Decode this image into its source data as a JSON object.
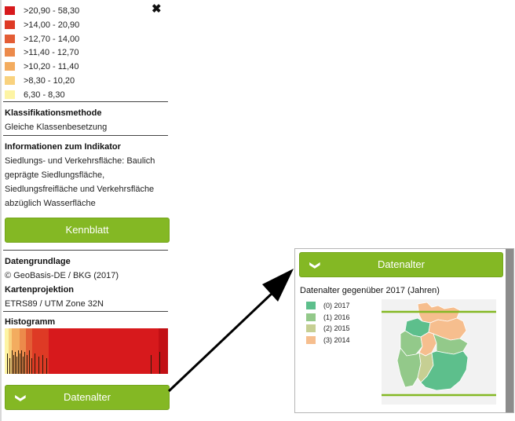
{
  "legend": {
    "classes": [
      {
        "label": ">20,90 - 58,30",
        "color": "#d7191c"
      },
      {
        "label": ">14,00 - 20,90",
        "color": "#de3a25"
      },
      {
        "label": ">12,70 - 14,00",
        "color": "#e35d35"
      },
      {
        "label": ">11,40 - 12,70",
        "color": "#ec8a4b"
      },
      {
        "label": ">10,20 - 11,40",
        "color": "#f3ac5f"
      },
      {
        "label": ">8,30 - 10,20",
        "color": "#f9d27e"
      },
      {
        "label": "6,30 - 8,30",
        "color": "#fdf4a4"
      }
    ]
  },
  "close_icon": "close-icon",
  "classification": {
    "heading": "Klassifikationsmethode",
    "value": "Gleiche Klassenbesetzung"
  },
  "indicator_info": {
    "heading": "Informationen zum Indikator",
    "lines": [
      "Siedlungs- und Verkehrsfläche: Baulich",
      "geprägte Siedlungsfläche,",
      "Siedlungsfreifläche und Verkehrsfläche",
      "abzüglich Wasserfläche"
    ]
  },
  "kennblatt_label": "Kennblatt",
  "data_basis": {
    "heading": "Datengrundlage",
    "value": "© GeoBasis-DE / BKG (2017)"
  },
  "projection": {
    "heading": "Kartenprojektion",
    "value": "ETRS89 / UTM Zone 32N"
  },
  "histogram": {
    "heading": "Histogramm"
  },
  "datenalter_label": "Datenalter",
  "datenalter_panel": {
    "heading": "Datenalter gegenüber 2017 (Jahren)",
    "years": [
      {
        "label": "(0) 2017",
        "color": "#5dbf8c"
      },
      {
        "label": "(1) 2016",
        "color": "#93c98a"
      },
      {
        "label": "(2) 2015",
        "color": "#c6cf93"
      },
      {
        "label": "(3) 2014",
        "color": "#f6be8e"
      }
    ]
  },
  "colors": {
    "accent": "#84b824"
  }
}
